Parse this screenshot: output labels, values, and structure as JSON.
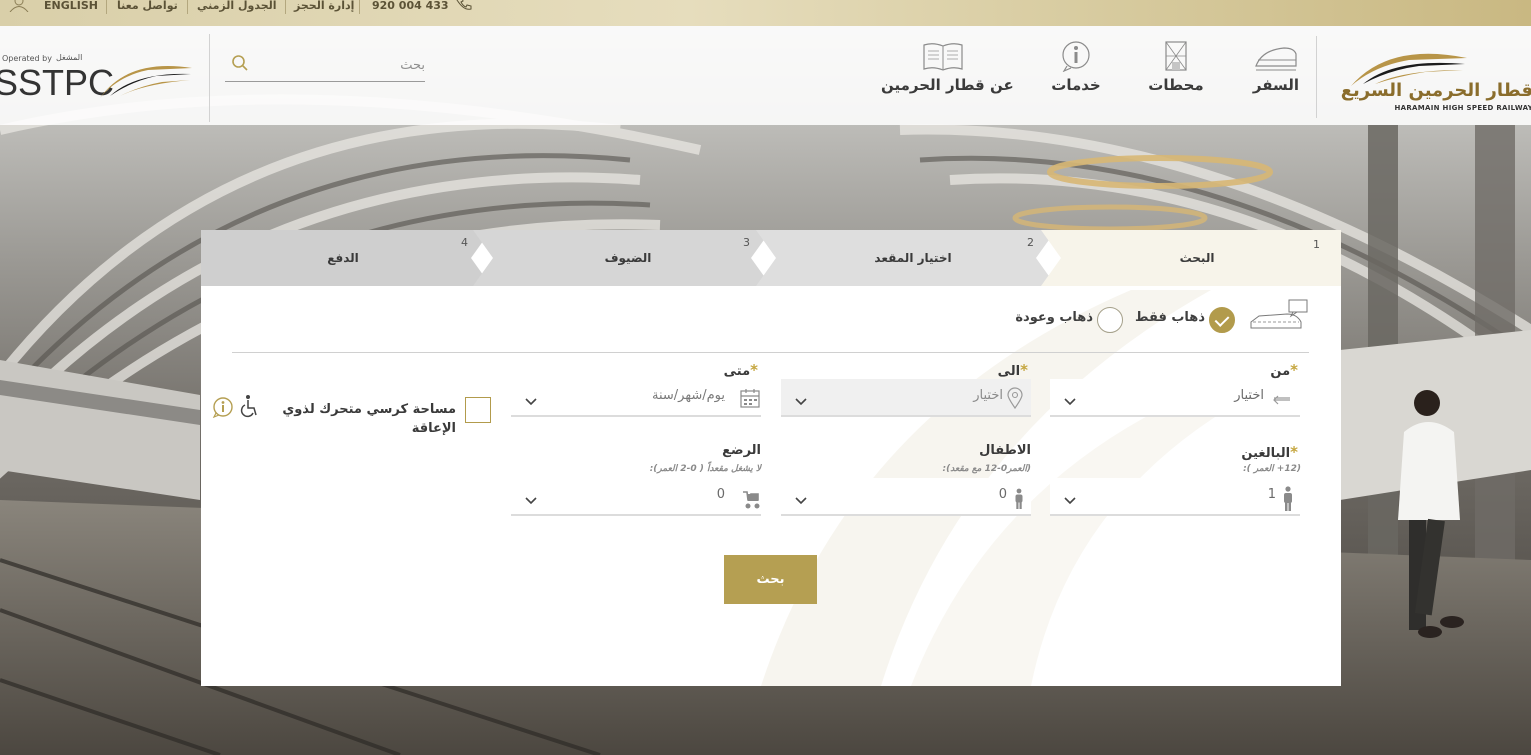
{
  "utility_bar": {
    "phone": "920 004 433",
    "manage_booking": "إدارة الحجز",
    "timetable": "الجدول الزمني",
    "contact": "تواصل معنا",
    "language": "ENGLISH"
  },
  "brand": {
    "name_ar": "قطار الحرمين السريع",
    "name_en": "HARAMAIN HIGH SPEED RAILWAY"
  },
  "nav": {
    "items": [
      {
        "label": "السفر",
        "icon": "train-icon"
      },
      {
        "label": "محطات",
        "icon": "station-icon"
      },
      {
        "label": "خدمات",
        "icon": "info-icon"
      },
      {
        "label": "عن قطار الحرمين",
        "icon": "book-icon"
      }
    ]
  },
  "search": {
    "placeholder": "بحث"
  },
  "operator": {
    "operated_by": "Operated by",
    "operated_by_ar": "المشغل",
    "name": "SSTPC"
  },
  "steps": [
    {
      "num": "1",
      "label": "البحث",
      "active": true
    },
    {
      "num": "2",
      "label": "اختيار المقعد",
      "active": false
    },
    {
      "num": "3",
      "label": "الضيوف",
      "active": false
    },
    {
      "num": "4",
      "label": "الدفع",
      "active": false
    }
  ],
  "trip_type": {
    "one_way": "ذهاب فقط",
    "round_trip": "ذهاب وعودة",
    "selected": "one_way"
  },
  "form": {
    "from": {
      "label": "من",
      "value": "اختيار"
    },
    "to": {
      "label": "الى",
      "value": "اختيار"
    },
    "when": {
      "label": "متى",
      "placeholder": "يوم/شهر/سنة"
    },
    "adults": {
      "label": "البالغين",
      "sub": "(12+ العمر ):",
      "value": "1"
    },
    "children": {
      "label": "الاطفال",
      "sub": "(العمر0-12 مع مقعد):",
      "value": "0"
    },
    "infants": {
      "label": "الرضع",
      "sub": "لا يشغل مقعداً ( 0-2 العمر):",
      "value": "0"
    },
    "wheelchair": {
      "label": "مساحة كرسي متحرك لذوي الإعاقة"
    },
    "search_button": "بحث"
  },
  "colors": {
    "accent_gold": "#b59f52",
    "utility_bar": "#ddd3b0",
    "step_active": "#f7f4ea",
    "step_inactive": "#cfcfcf"
  }
}
